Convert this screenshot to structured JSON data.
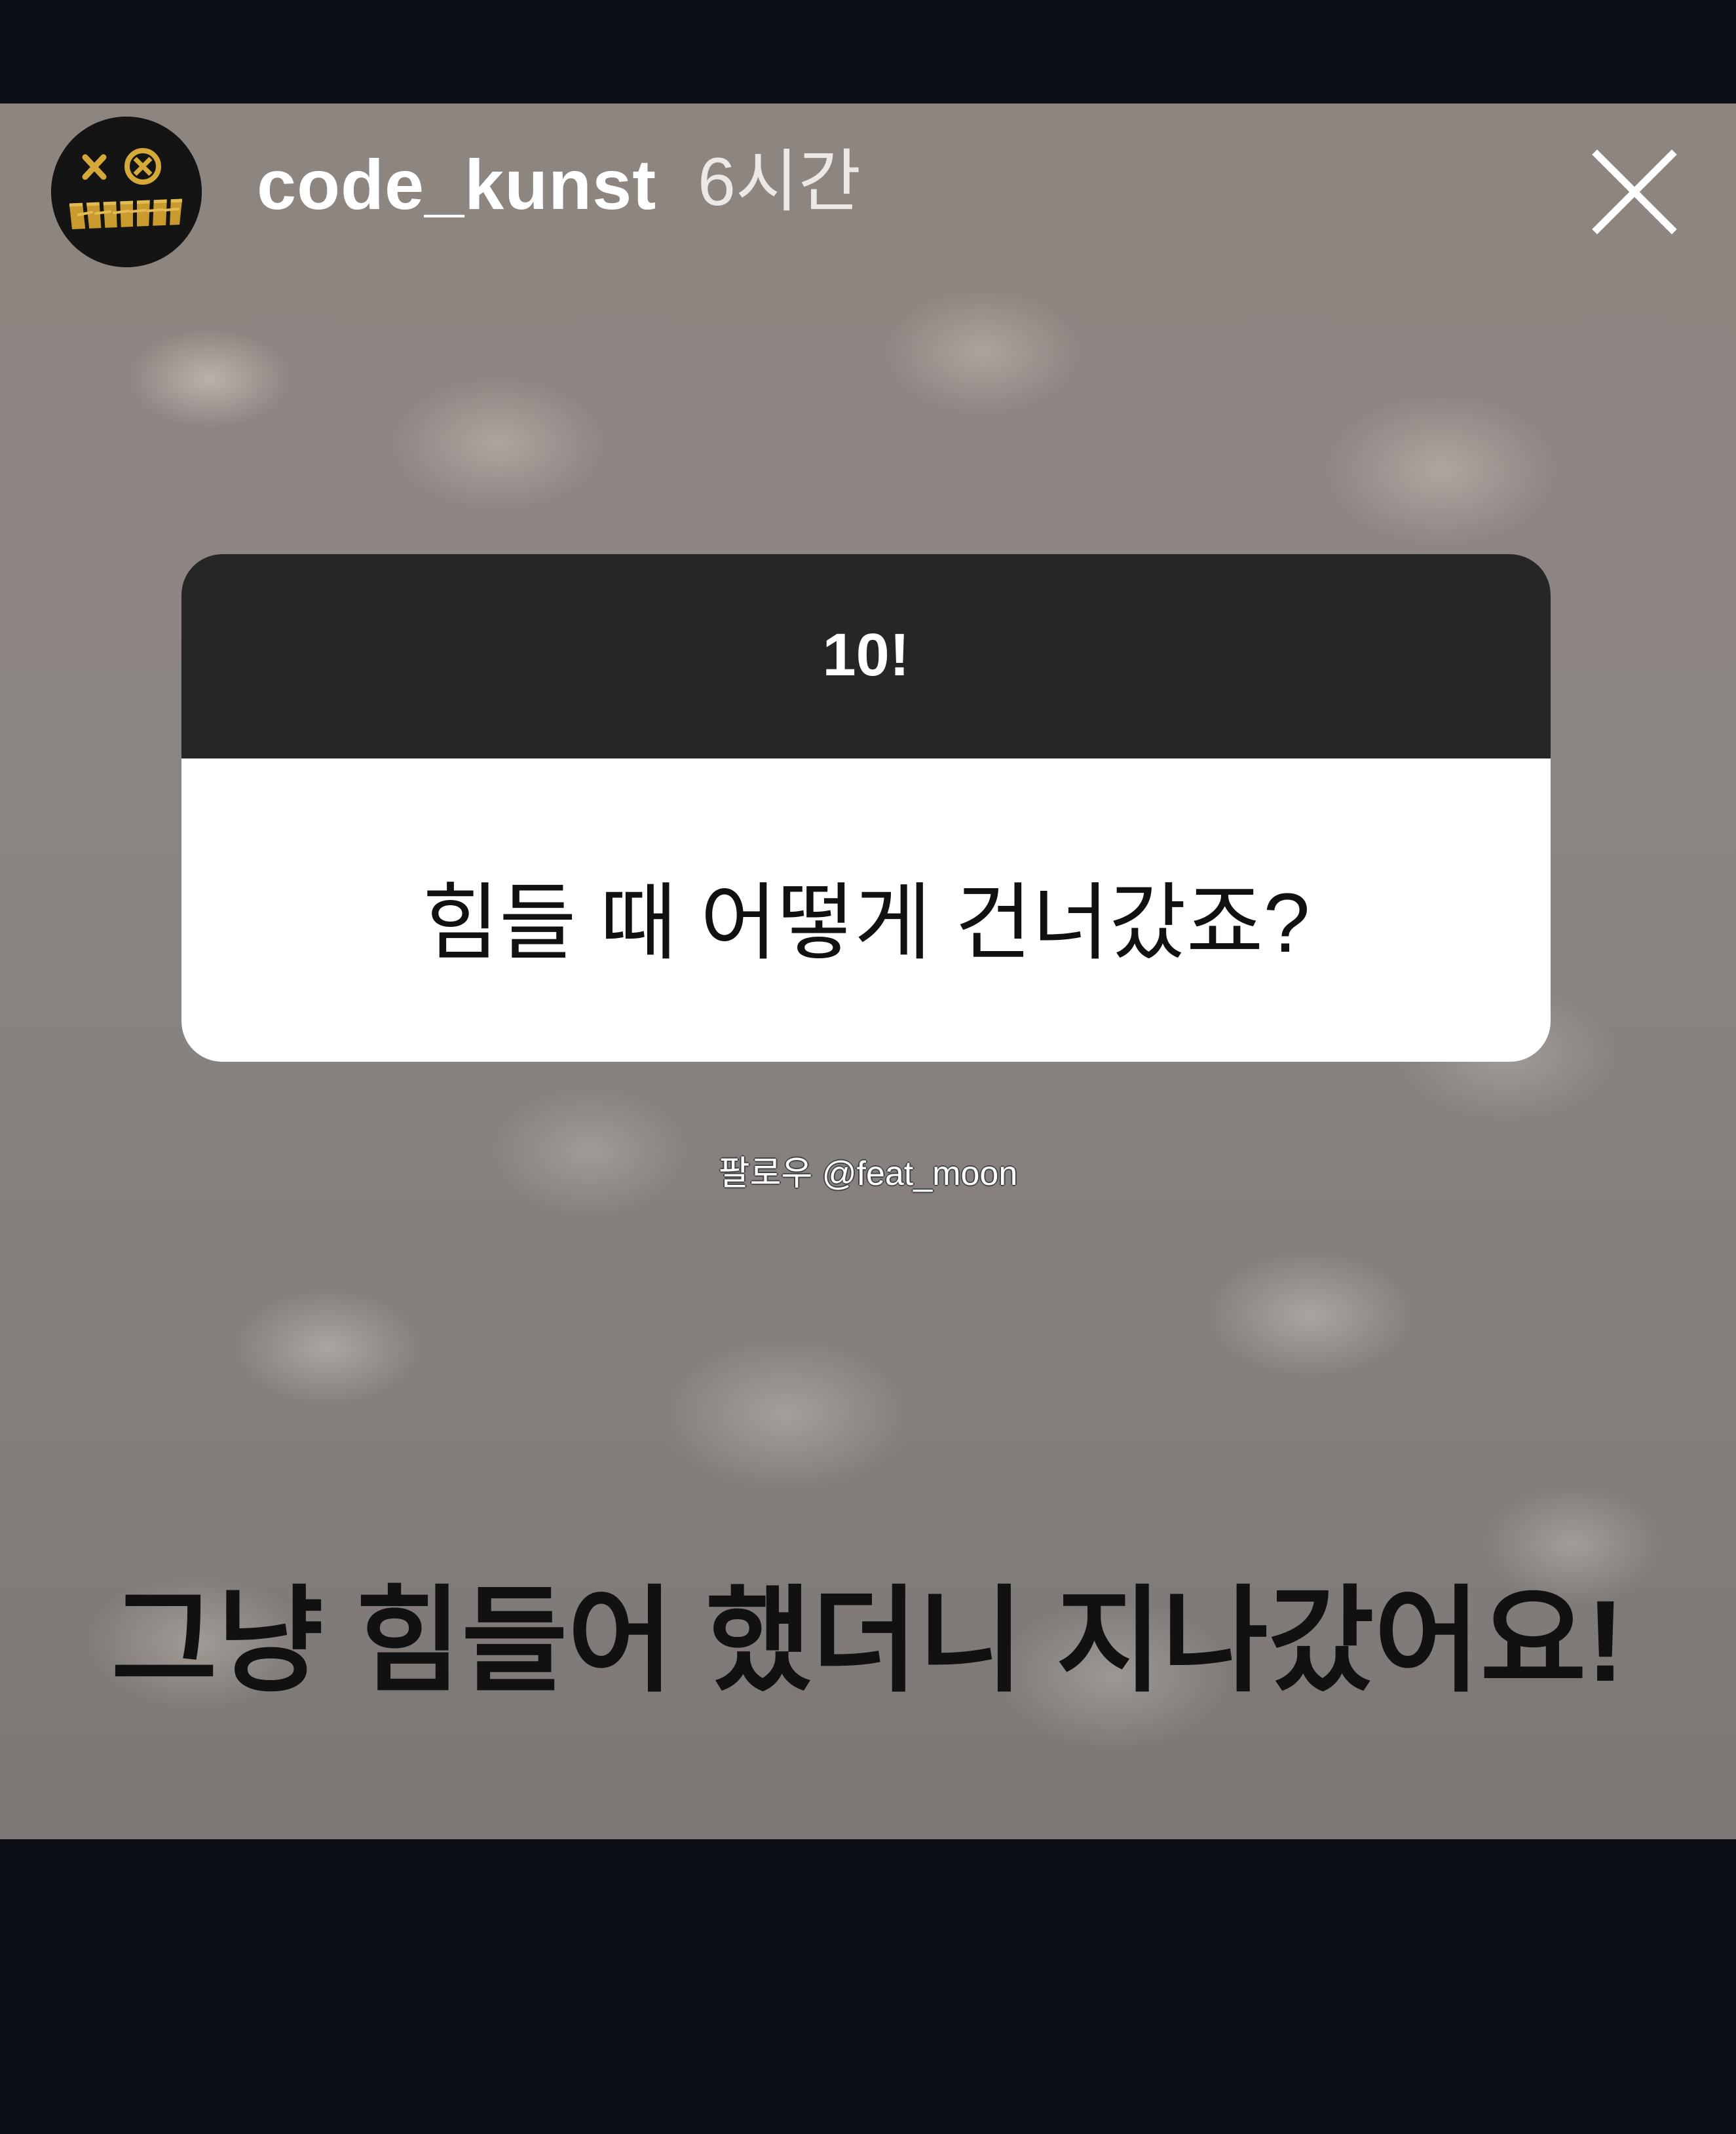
{
  "story": {
    "username": "code_kunst",
    "time_ago": "6시간",
    "avatar_icon": "skull-logo-icon",
    "close_icon": "close-icon"
  },
  "question_box": {
    "title": "10!",
    "question": "힘들 때 어떻게 건너갔죠?"
  },
  "watermark": "팔로우 @feat_moon",
  "answer": "그냥 힘들어 했더니 지나갔어요!",
  "colors": {
    "background": "#0b0f15",
    "story_bg": "#8b8582",
    "question_header": "#262626",
    "question_body": "#ffffff",
    "avatar_gold": "#d4a93a"
  }
}
